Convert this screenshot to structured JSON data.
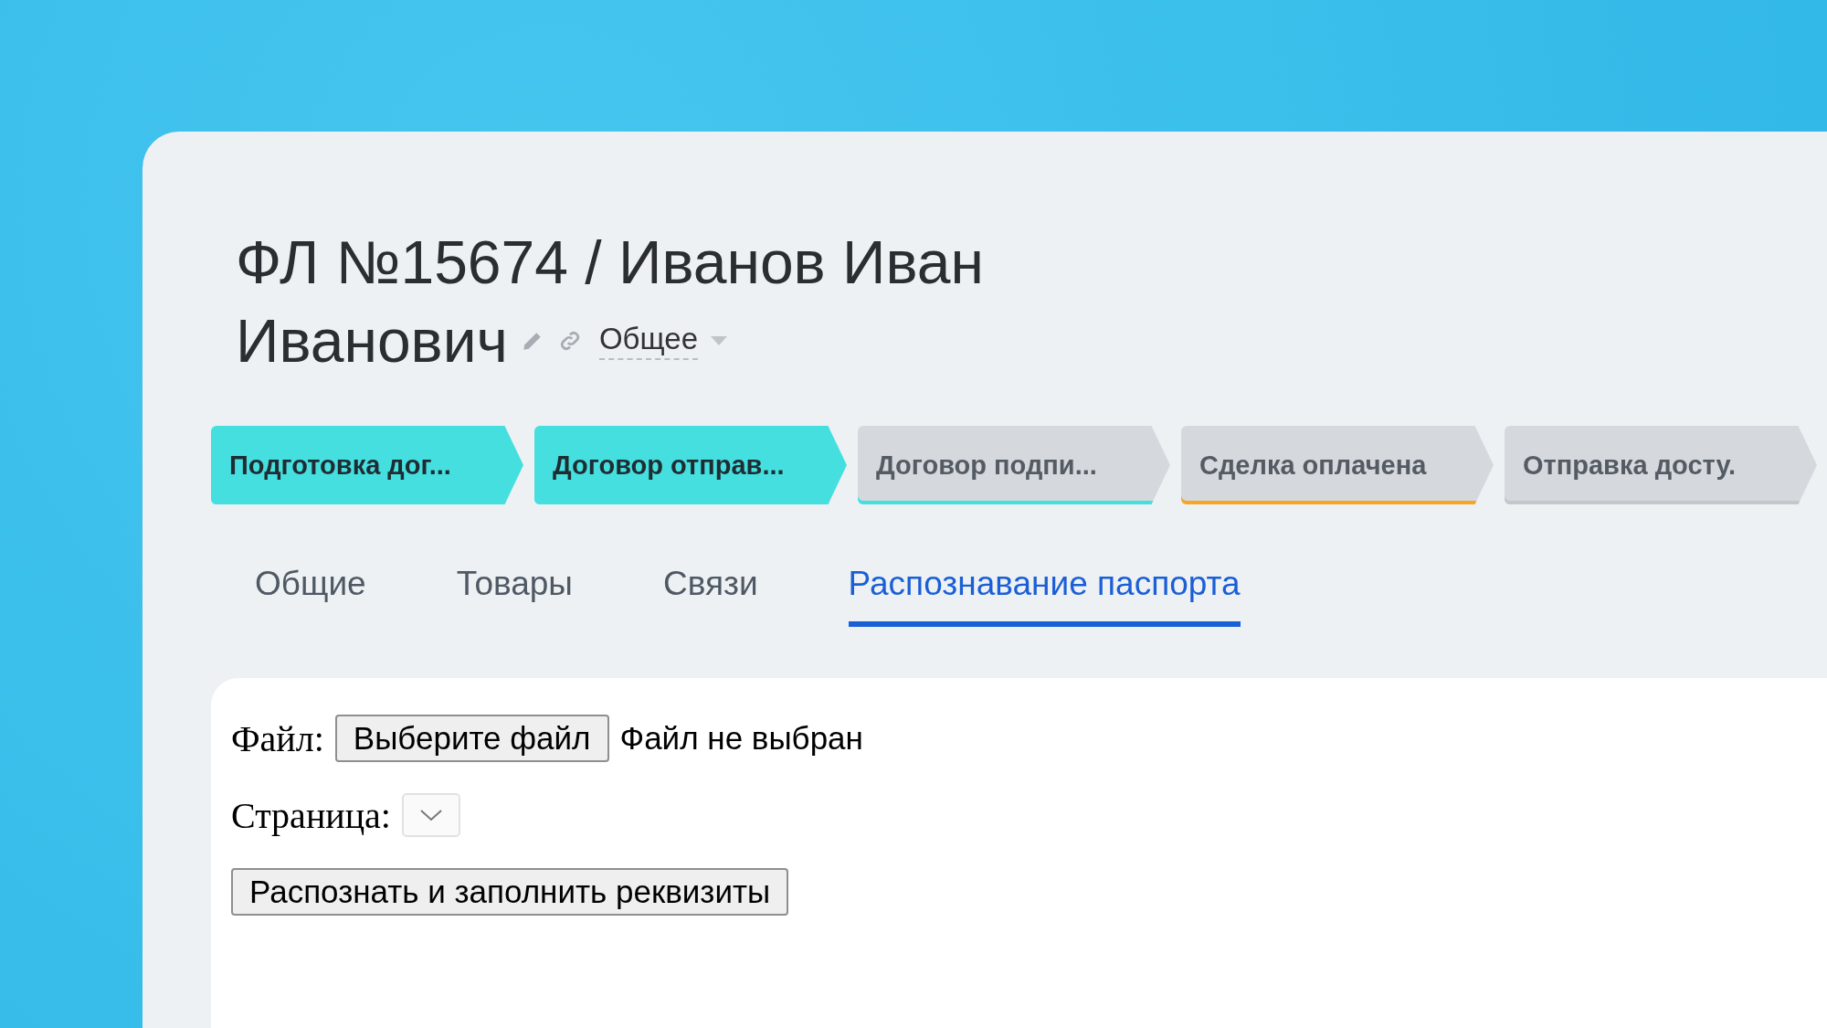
{
  "title": {
    "line_1": "ФЛ №15674 / Иванов Иван",
    "line_2": "Иванович",
    "category": "Общее"
  },
  "stages": [
    {
      "label": "Подготовка дог...",
      "color": "#45dfdf",
      "reached": true
    },
    {
      "label": "Договор отправ...",
      "color": "#45dfdf",
      "reached": true
    },
    {
      "label": "Договор подпи...",
      "color": "#45dfdf",
      "reached": false
    },
    {
      "label": "Сделка оплачена",
      "color": "#f5a623",
      "reached": false
    },
    {
      "label": "Отправка досту.",
      "color": "#c3c7cc",
      "reached": false
    }
  ],
  "tabs": [
    {
      "label": "Общие",
      "selected": false
    },
    {
      "label": "Товары",
      "selected": false
    },
    {
      "label": "Связи",
      "selected": false
    },
    {
      "label": "Распознавание паспорта",
      "selected": true
    }
  ],
  "form": {
    "file_label": "Файл:",
    "file_button": "Выберите файл",
    "file_status": "Файл не выбран",
    "page_label": "Страница:",
    "submit": "Распознать и заполнить реквизиты"
  }
}
